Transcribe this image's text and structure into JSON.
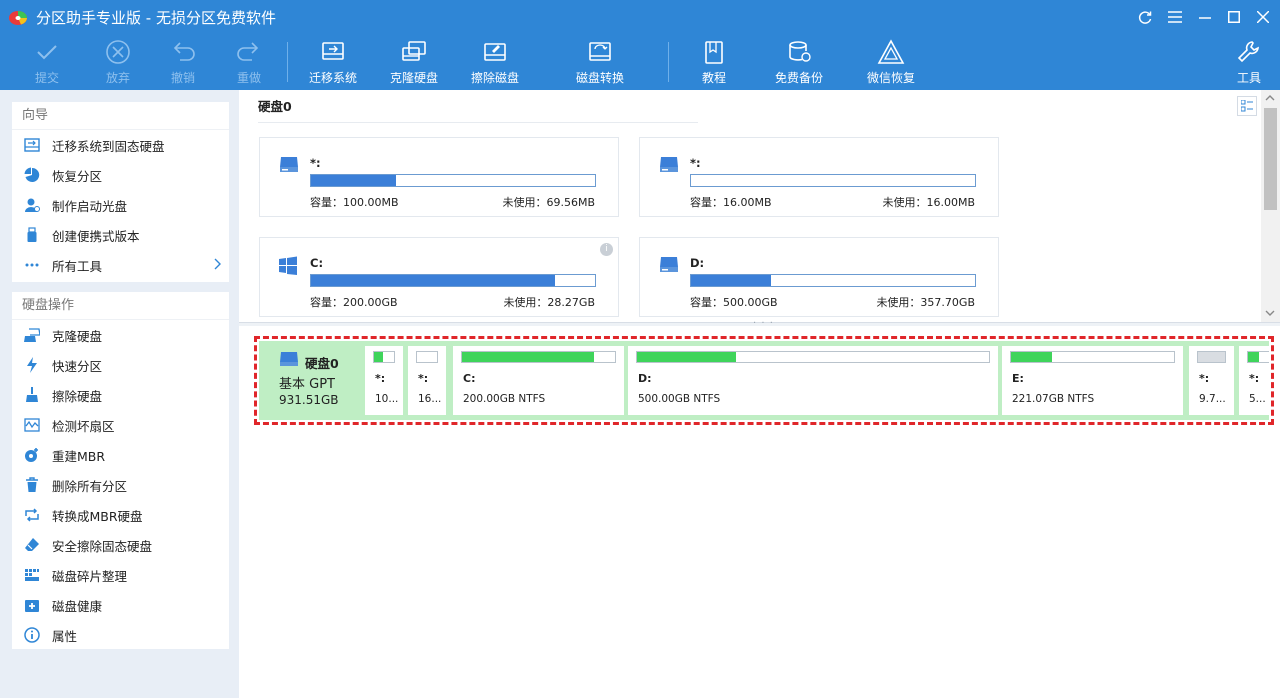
{
  "window": {
    "title": "分区助手专业版 - 无损分区免费软件",
    "colors": {
      "accent": "#2f86d6",
      "bar_blue": "#3b7fd8",
      "bar_green": "#3fd45b",
      "highlight": "#e0262a",
      "selected_bg": "#bfeec4"
    }
  },
  "toolbar": {
    "commit": "提交",
    "discard": "放弃",
    "undo": "撤销",
    "redo": "重做",
    "migrate_os": "迁移系统",
    "clone_disk": "克隆硬盘",
    "wipe_disk": "擦除磁盘",
    "convert_disk": "磁盘转换",
    "tutorial": "教程",
    "free_backup": "免费备份",
    "wechat_recovery": "微信恢复",
    "tools": "工具"
  },
  "sidebar": {
    "wizard_title": "向导",
    "wizard_items": [
      {
        "label": "迁移系统到固态硬盘",
        "icon": "migrate-icon"
      },
      {
        "label": "恢复分区",
        "icon": "pie-icon"
      },
      {
        "label": "制作启动光盘",
        "icon": "user-disc-icon"
      },
      {
        "label": "创建便携式版本",
        "icon": "usb-icon"
      },
      {
        "label": "所有工具",
        "icon": "more-icon"
      }
    ],
    "disk_ops_title": "硬盘操作",
    "disk_ops_items": [
      {
        "label": "克隆硬盘",
        "icon": "clone-icon"
      },
      {
        "label": "快速分区",
        "icon": "lightning-icon"
      },
      {
        "label": "擦除硬盘",
        "icon": "broom-icon"
      },
      {
        "label": "检测坏扇区",
        "icon": "waveform-icon"
      },
      {
        "label": "重建MBR",
        "icon": "rebuild-icon"
      },
      {
        "label": "删除所有分区",
        "icon": "trash-icon"
      },
      {
        "label": "转换成MBR硬盘",
        "icon": "convert-icon"
      },
      {
        "label": "安全擦除固态硬盘",
        "icon": "eraser-icon"
      },
      {
        "label": "磁盘碎片整理",
        "icon": "defrag-icon"
      },
      {
        "label": "磁盘健康",
        "icon": "health-icon"
      },
      {
        "label": "属性",
        "icon": "info-icon"
      }
    ]
  },
  "disk_header": {
    "name": "硬盘0"
  },
  "cards": [
    {
      "name": "*:",
      "capacity": "容量：100.00MB",
      "free": "未使用：69.56MB",
      "used_fraction": 0.3,
      "icon": "drive-icon"
    },
    {
      "name": "*:",
      "capacity": "容量：16.00MB",
      "free": "未使用：16.00MB",
      "used_fraction": 0.0,
      "icon": "drive-icon"
    },
    {
      "name": "C:",
      "capacity": "容量：200.00GB",
      "free": "未使用：28.27GB",
      "used_fraction": 0.86,
      "icon": "windows-icon"
    },
    {
      "name": "D:",
      "capacity": "容量：500.00GB",
      "free": "未使用：357.70GB",
      "used_fraction": 0.28,
      "icon": "drive-icon"
    }
  ],
  "diskmap": {
    "disk_name": "硬盘0",
    "disk_type": "基本 GPT",
    "disk_size": "931.51GB",
    "partitions": [
      {
        "label": "*:",
        "info": "10...",
        "used_fraction": 0.45
      },
      {
        "label": "*:",
        "info": "16...",
        "used_fraction": 0.0
      },
      {
        "label": "C:",
        "info": "200.00GB NTFS",
        "used_fraction": 0.86
      },
      {
        "label": "D:",
        "info": "500.00GB NTFS",
        "used_fraction": 0.28
      },
      {
        "label": "E:",
        "info": "221.07GB NTFS",
        "used_fraction": 0.25
      },
      {
        "label": "*:",
        "info": "9.7...",
        "used_fraction": 0.0
      },
      {
        "label": "*:",
        "info": "5...",
        "used_fraction": 0.5
      }
    ]
  }
}
